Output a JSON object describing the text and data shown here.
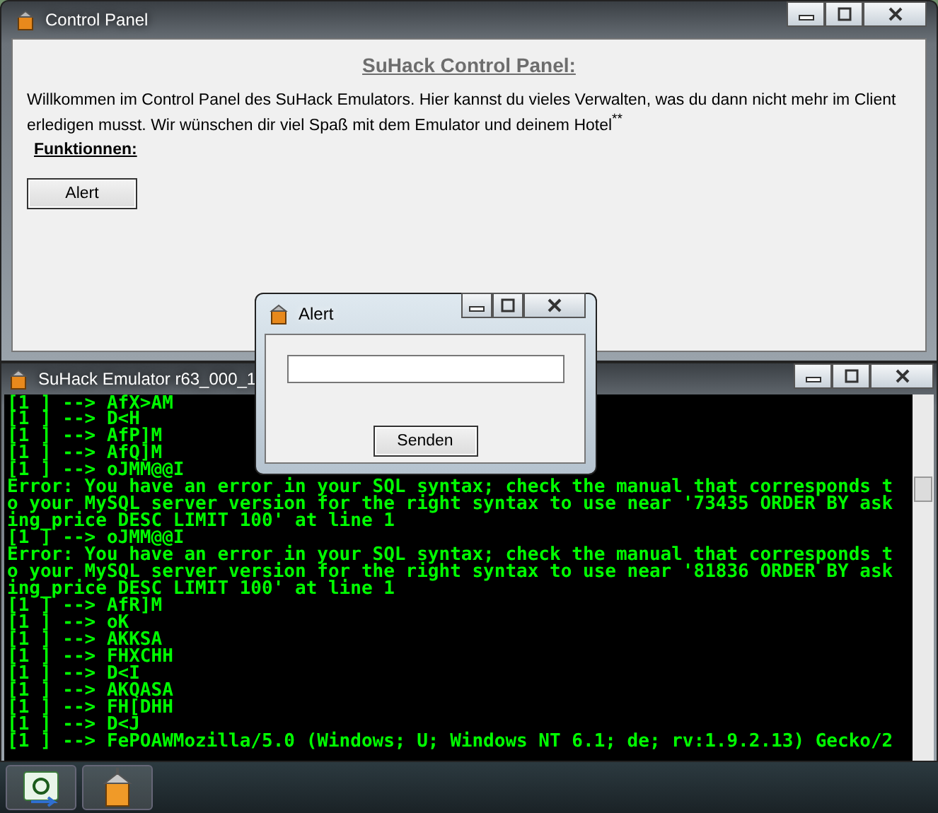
{
  "control_panel": {
    "title": "Control Panel",
    "heading": "SuHack Control Panel:",
    "intro": "Willkommen im Control Panel des SuHack Emulators. Hier kannst du vieles Verwalten, was du dann nicht mehr im Client erledigen musst. Wir wünschen dir viel Spaß mit dem Emulator und deinem Hotel$^{**}$",
    "section_label": "Funktionnen:",
    "buttons": [
      "Alert"
    ]
  },
  "emulator": {
    "title": "SuHack Emulator r63_000_1",
    "console_lines": [
      "[1 ] --> AfX>AM",
      "[1 ] --> D<H",
      "[1 ] --> AfP]M",
      "[1 ] --> AfQ]M",
      "[1 ] --> oJMM@@I",
      "Error: You have an error in your SQL syntax; check the manual that corresponds t",
      "o your MySQL server version for the right syntax to use near '73435 ORDER BY ask",
      "ing_price DESC LIMIT 100' at line 1",
      "[1 ] --> oJMM@@I",
      "Error: You have an error in your SQL syntax; check the manual that corresponds t",
      "o your MySQL server version for the right syntax to use near '81836 ORDER BY ask",
      "ing_price DESC LIMIT 100' at line 1",
      "[1 ] --> AfR]M",
      "[1 ] --> oK",
      "[1 ] --> AKKSA",
      "[1 ] --> FHXCHH",
      "[1 ] --> D<I",
      "[1 ] --> AKQASA",
      "[1 ] --> FH[DHH",
      "[1 ] --> D<J",
      "[1 ] --> FePOAWMozilla/5.0 (Windows; U; Windows NT 6.1; de; rv:1.9.2.13) Gecko/2"
    ]
  },
  "alert_dialog": {
    "title": "Alert",
    "button": "Senden"
  },
  "taskbar": {
    "items": [
      {
        "kind": "csharp"
      },
      {
        "kind": "suhack"
      }
    ]
  }
}
